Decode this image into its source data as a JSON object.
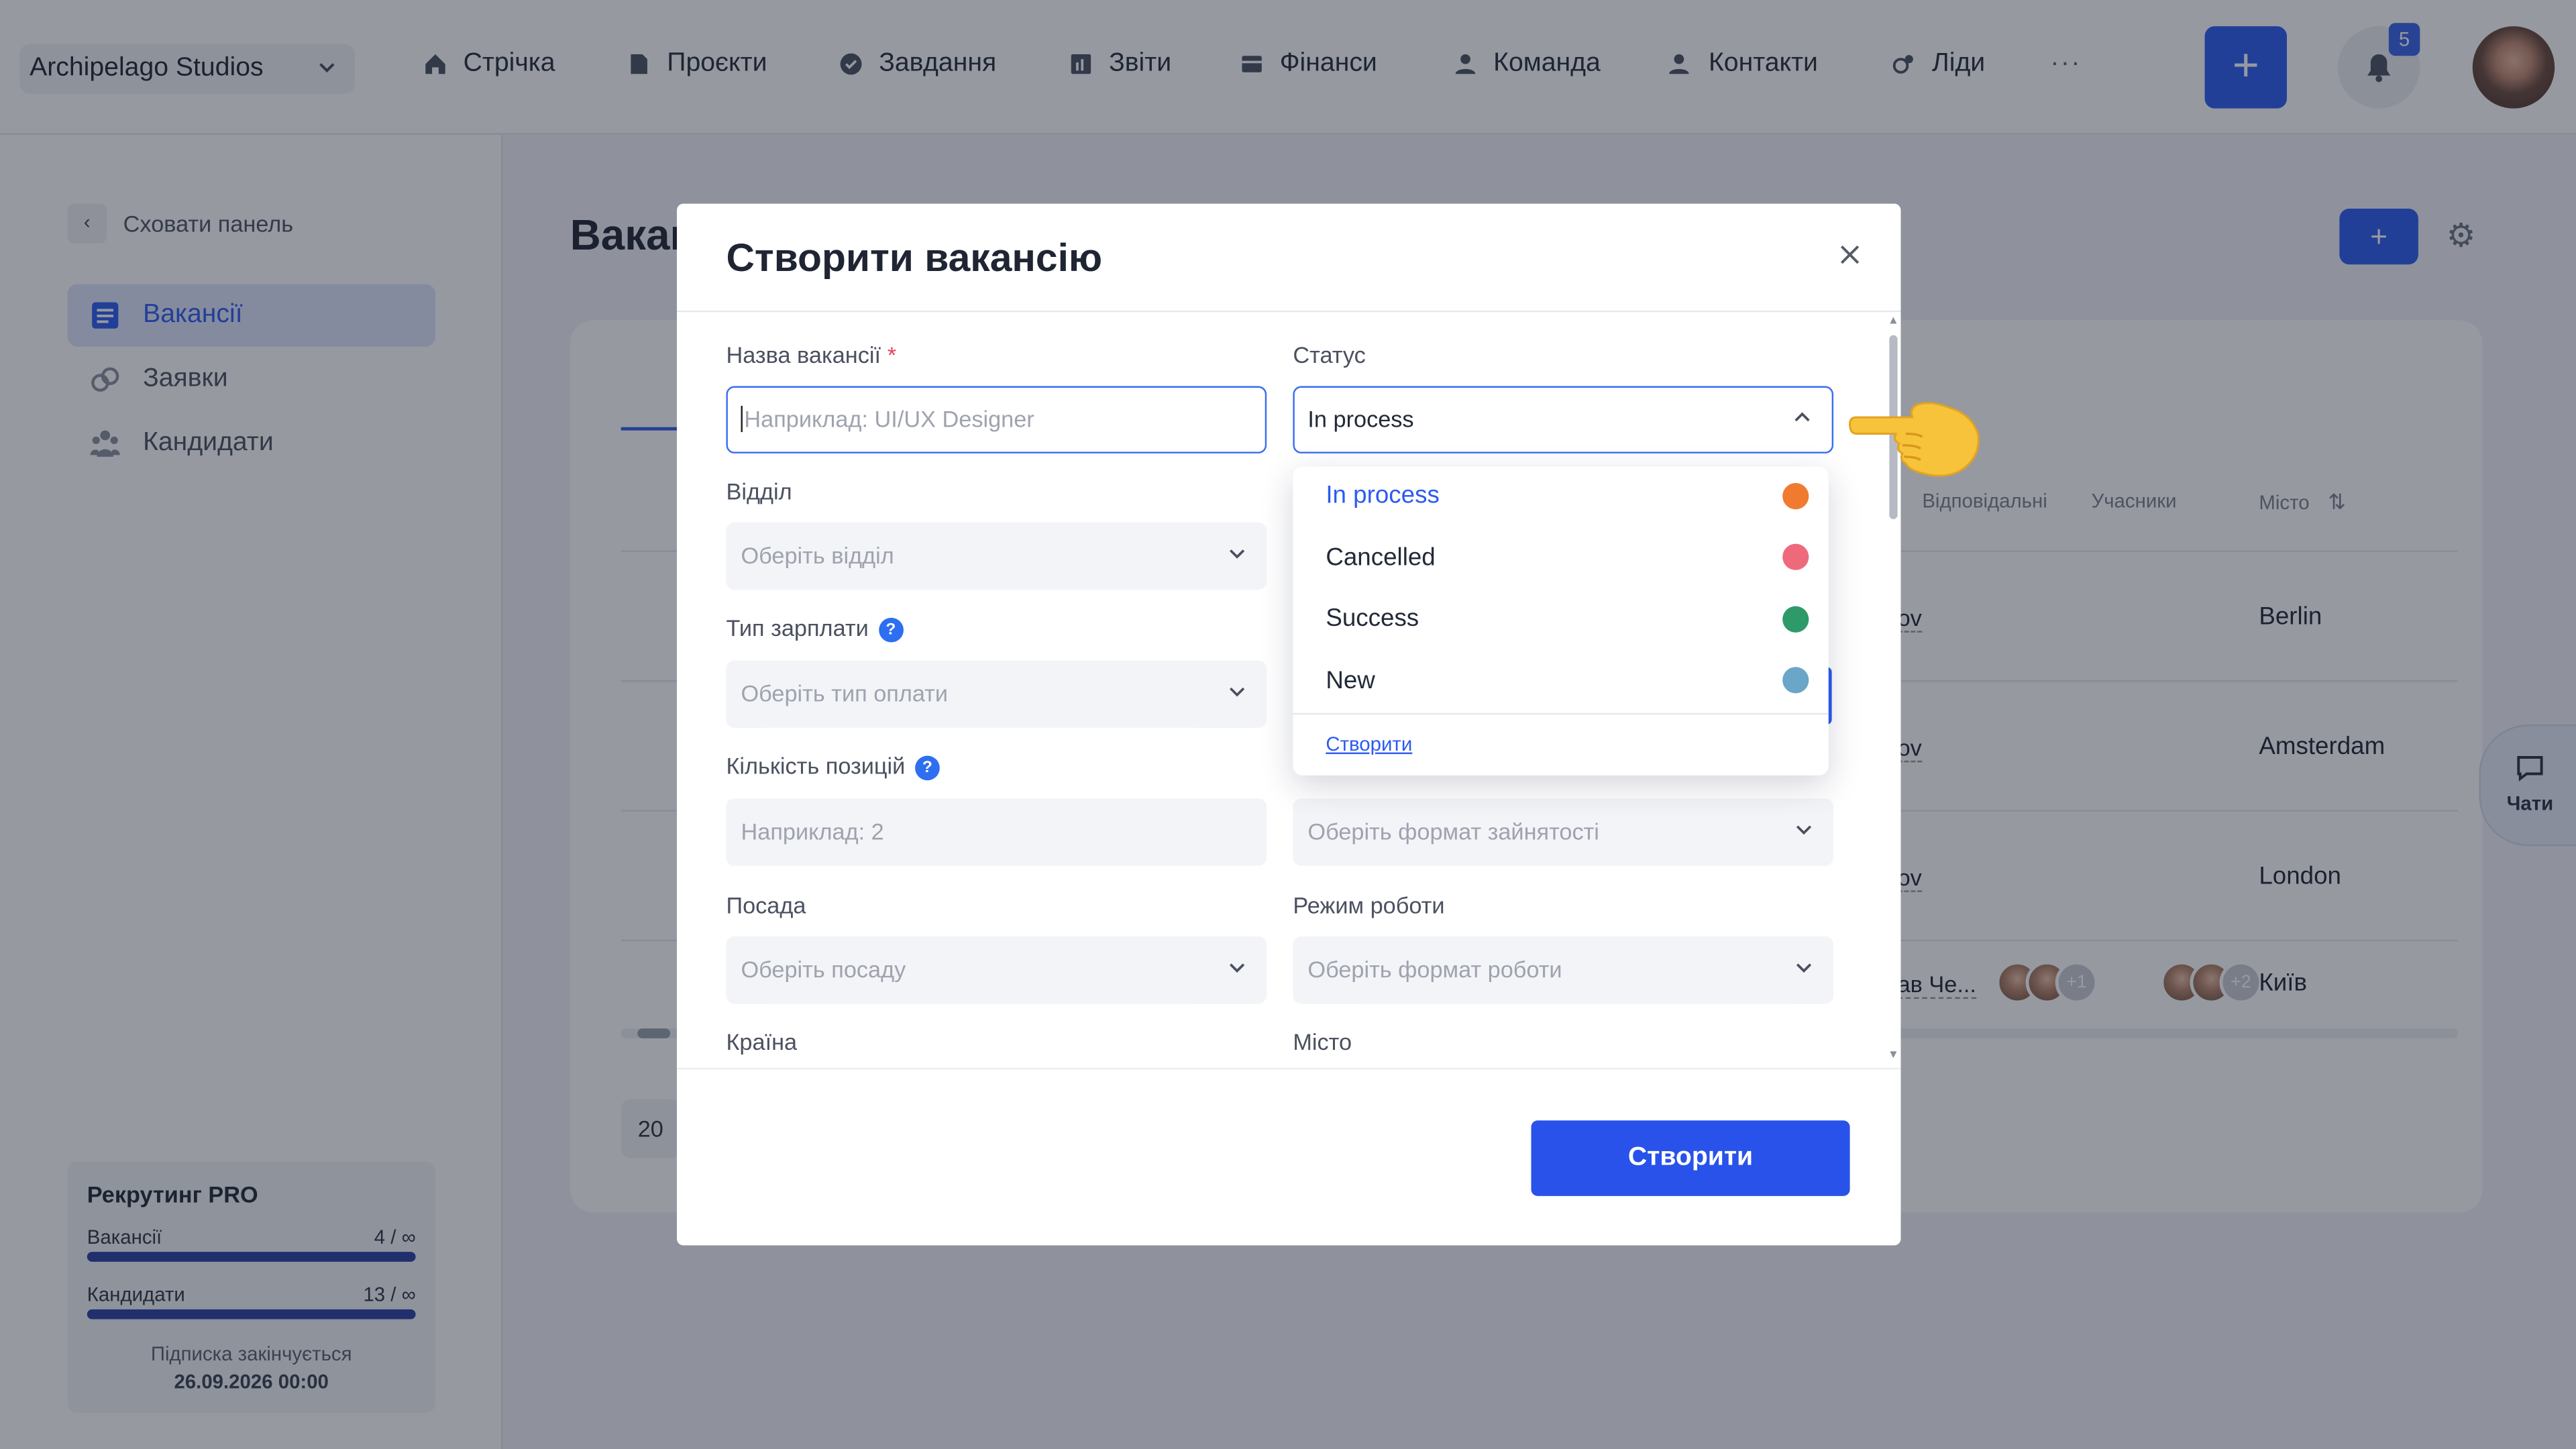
{
  "topbar": {
    "org_name": "Archipelago Studios",
    "nav": [
      {
        "label": "Стрічка",
        "icon": "home-icon"
      },
      {
        "label": "Проєкти",
        "icon": "document-icon"
      },
      {
        "label": "Завдання",
        "icon": "check-circle-icon"
      },
      {
        "label": "Звіти",
        "icon": "report-icon"
      },
      {
        "label": "Фінанси",
        "icon": "wallet-icon"
      },
      {
        "label": "Команда",
        "icon": "user-icon"
      },
      {
        "label": "Контакти",
        "icon": "contacts-icon"
      },
      {
        "label": "Ліди",
        "icon": "leads-icon"
      }
    ],
    "more": "···",
    "add_label": "+",
    "notifications_count": "5"
  },
  "sidebar": {
    "hide_label": "Сховати панель",
    "items": [
      {
        "label": "Вакансії",
        "icon": "list-icon",
        "active": true
      },
      {
        "label": "Заявки",
        "icon": "link-icon",
        "active": false
      },
      {
        "label": "Кандидати",
        "icon": "people-icon",
        "active": false
      }
    ],
    "plan": {
      "title": "Рекрутинг PRO",
      "vacancies_label": "Вакансії",
      "vacancies_value": "4 / ∞",
      "candidates_label": "Кандидати",
      "candidates_value": "13 / ∞",
      "expires_label": "Підписка закінчується",
      "expires_date": "26.09.2026 00:00"
    }
  },
  "background": {
    "page_title": "Вакан",
    "add_label": "+",
    "columns": [
      "Відповідальні",
      "Учасники",
      "Місто"
    ],
    "rows": [
      {
        "resp": "ov",
        "city": "Berlin"
      },
      {
        "resp": "ov",
        "city": "Amsterdam"
      },
      {
        "resp": "ov",
        "city": "London"
      },
      {
        "resp": "ав Че...",
        "city": "Київ",
        "resp_more": "+1",
        "part_more": "+2"
      }
    ],
    "page_size": "20",
    "chats_label": "Чати"
  },
  "modal": {
    "title": "Створити вакансію",
    "fields": {
      "name_label": "Назва вакансії",
      "name_required": "*",
      "name_placeholder": "Наприклад: UI/UX Designer",
      "status_label": "Статус",
      "status_value": "In process",
      "dept_label": "Відділ",
      "dept_placeholder": "Оберіть відділ",
      "salary_label": "Тип зарплати",
      "salary_placeholder": "Оберіть тип оплати",
      "count_label": "Кількість позицій",
      "count_placeholder": "Наприклад: 2",
      "employment_placeholder": "Оберіть формат зайнятості",
      "position_label": "Посада",
      "position_placeholder": "Оберіть посаду",
      "mode_label": "Режим роботи",
      "mode_placeholder": "Оберіть формат роботи",
      "country_label": "Країна",
      "city_label": "Місто"
    },
    "submit_label": "Створити"
  },
  "status_dropdown": {
    "options": [
      {
        "label": "In process",
        "color": "#f07a30",
        "selected": true
      },
      {
        "label": "Cancelled",
        "color": "#ee6a7b",
        "selected": false
      },
      {
        "label": "Success",
        "color": "#2e9a6a",
        "selected": false
      },
      {
        "label": "New",
        "color": "#6aa6c8",
        "selected": false
      }
    ],
    "create_label": "Створити"
  },
  "colors": {
    "accent": "#2d5bf0",
    "overlay": "rgba(22,28,44,0.45)"
  }
}
